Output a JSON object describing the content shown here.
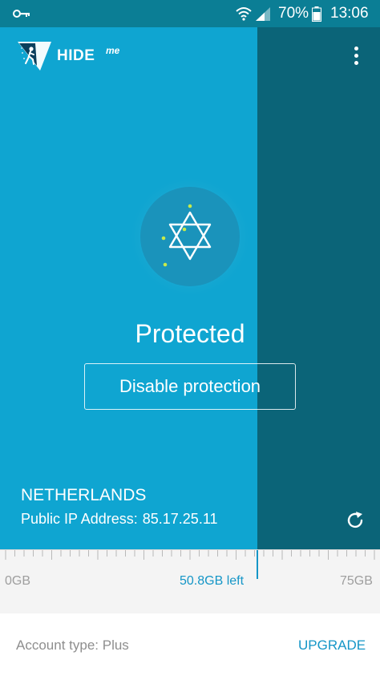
{
  "status_bar": {
    "battery_percent": "70%",
    "time": "13:06",
    "icons": [
      "key-icon",
      "wifi-icon",
      "signal-icon",
      "battery-icon"
    ]
  },
  "app": {
    "brand": "HIDE",
    "brand_sub": "me",
    "menu_icon": "more-vert-icon"
  },
  "protection": {
    "status": "Protected",
    "button_label": "Disable protection",
    "icon": "star-of-david-icon"
  },
  "location": {
    "country": "NETHERLANDS",
    "ip_label": "Public IP Address:",
    "ip_value": "85.17.25.11",
    "refresh_icon": "refresh-icon"
  },
  "usage": {
    "min_label": "0GB",
    "remaining_label": "50.8GB left",
    "max_label": "75GB",
    "used_fraction": 0.677
  },
  "account": {
    "type_label": "Account type: Plus",
    "upgrade_label": "UPGRADE"
  },
  "colors": {
    "primary": "#0fa5d1",
    "primary_dark": "#0b6478",
    "accent": "#1596c7"
  }
}
